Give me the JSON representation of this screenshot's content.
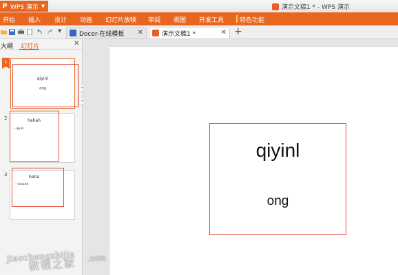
{
  "app": {
    "name": "WPS 演示",
    "window_title": "演示文稿1 * - WPS 演示"
  },
  "menu": [
    {
      "label": "开始"
    },
    {
      "label": "插入"
    },
    {
      "label": "设计"
    },
    {
      "label": "动画"
    },
    {
      "label": "幻灯片放映"
    },
    {
      "label": "审阅"
    },
    {
      "label": "视图"
    },
    {
      "label": "开发工具"
    },
    {
      "label": "特色功能"
    }
  ],
  "tabs": [
    {
      "label": "Docer-在线模板",
      "icon": "docer-icon"
    },
    {
      "label": "演示文稿1 *",
      "icon": "presentation-icon"
    }
  ],
  "left_panel": {
    "tab_outline": "大纲",
    "tab_slides": "幻灯片"
  },
  "slides": [
    {
      "number": "1",
      "title": "qiyinl",
      "subtitle": "ong"
    },
    {
      "number": "2",
      "title": "hahah",
      "bullet": "• qiyinl"
    },
    {
      "number": "3",
      "title": "haha",
      "bullet": "• hanarth"
    }
  ],
  "current_slide": {
    "title": "qiyinl",
    "subtitle": "ong"
  },
  "watermark": {
    "line1": "jiaochengzhijia",
    "line2": "教程之家",
    "suffix": ".com"
  },
  "colors": {
    "accent": "#e8661e",
    "selection_red": "#e04a3a"
  }
}
